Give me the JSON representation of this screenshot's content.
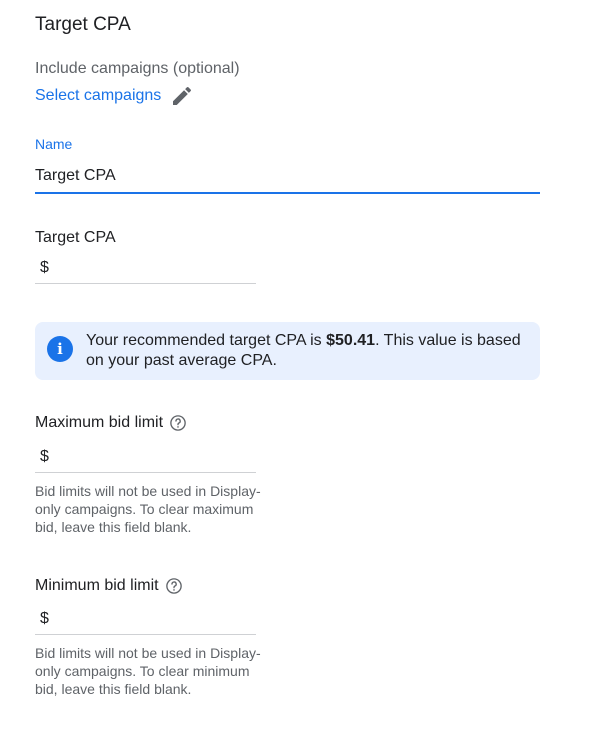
{
  "header": {
    "title": "Target CPA",
    "include_label": "Include campaigns (optional)",
    "select_link": "Select campaigns",
    "edit_icon": "pencil-icon"
  },
  "name_field": {
    "label": "Name",
    "value": "Target CPA"
  },
  "target_cpa": {
    "label": "Target CPA",
    "currency": "$",
    "value": ""
  },
  "recommendation": {
    "icon": "info-icon",
    "text_before": "Your recommended target CPA is ",
    "amount": "$50.41",
    "text_after": ". This value is based on your past average CPA."
  },
  "max_bid": {
    "label": "Maximum bid limit",
    "help_icon": "help-circle-icon",
    "currency": "$",
    "value": "",
    "hint": "Bid limits will not be used in Display-only campaigns. To clear maximum bid, leave this field blank."
  },
  "min_bid": {
    "label": "Minimum bid limit",
    "help_icon": "help-circle-icon",
    "currency": "$",
    "value": "",
    "hint": "Bid limits will not be used in Display-only campaigns. To clear minimum bid, leave this field blank."
  },
  "colors": {
    "accent": "#1a73e8",
    "info_bg": "#e8f0fe",
    "text": "#202124",
    "muted": "#5f6368"
  }
}
